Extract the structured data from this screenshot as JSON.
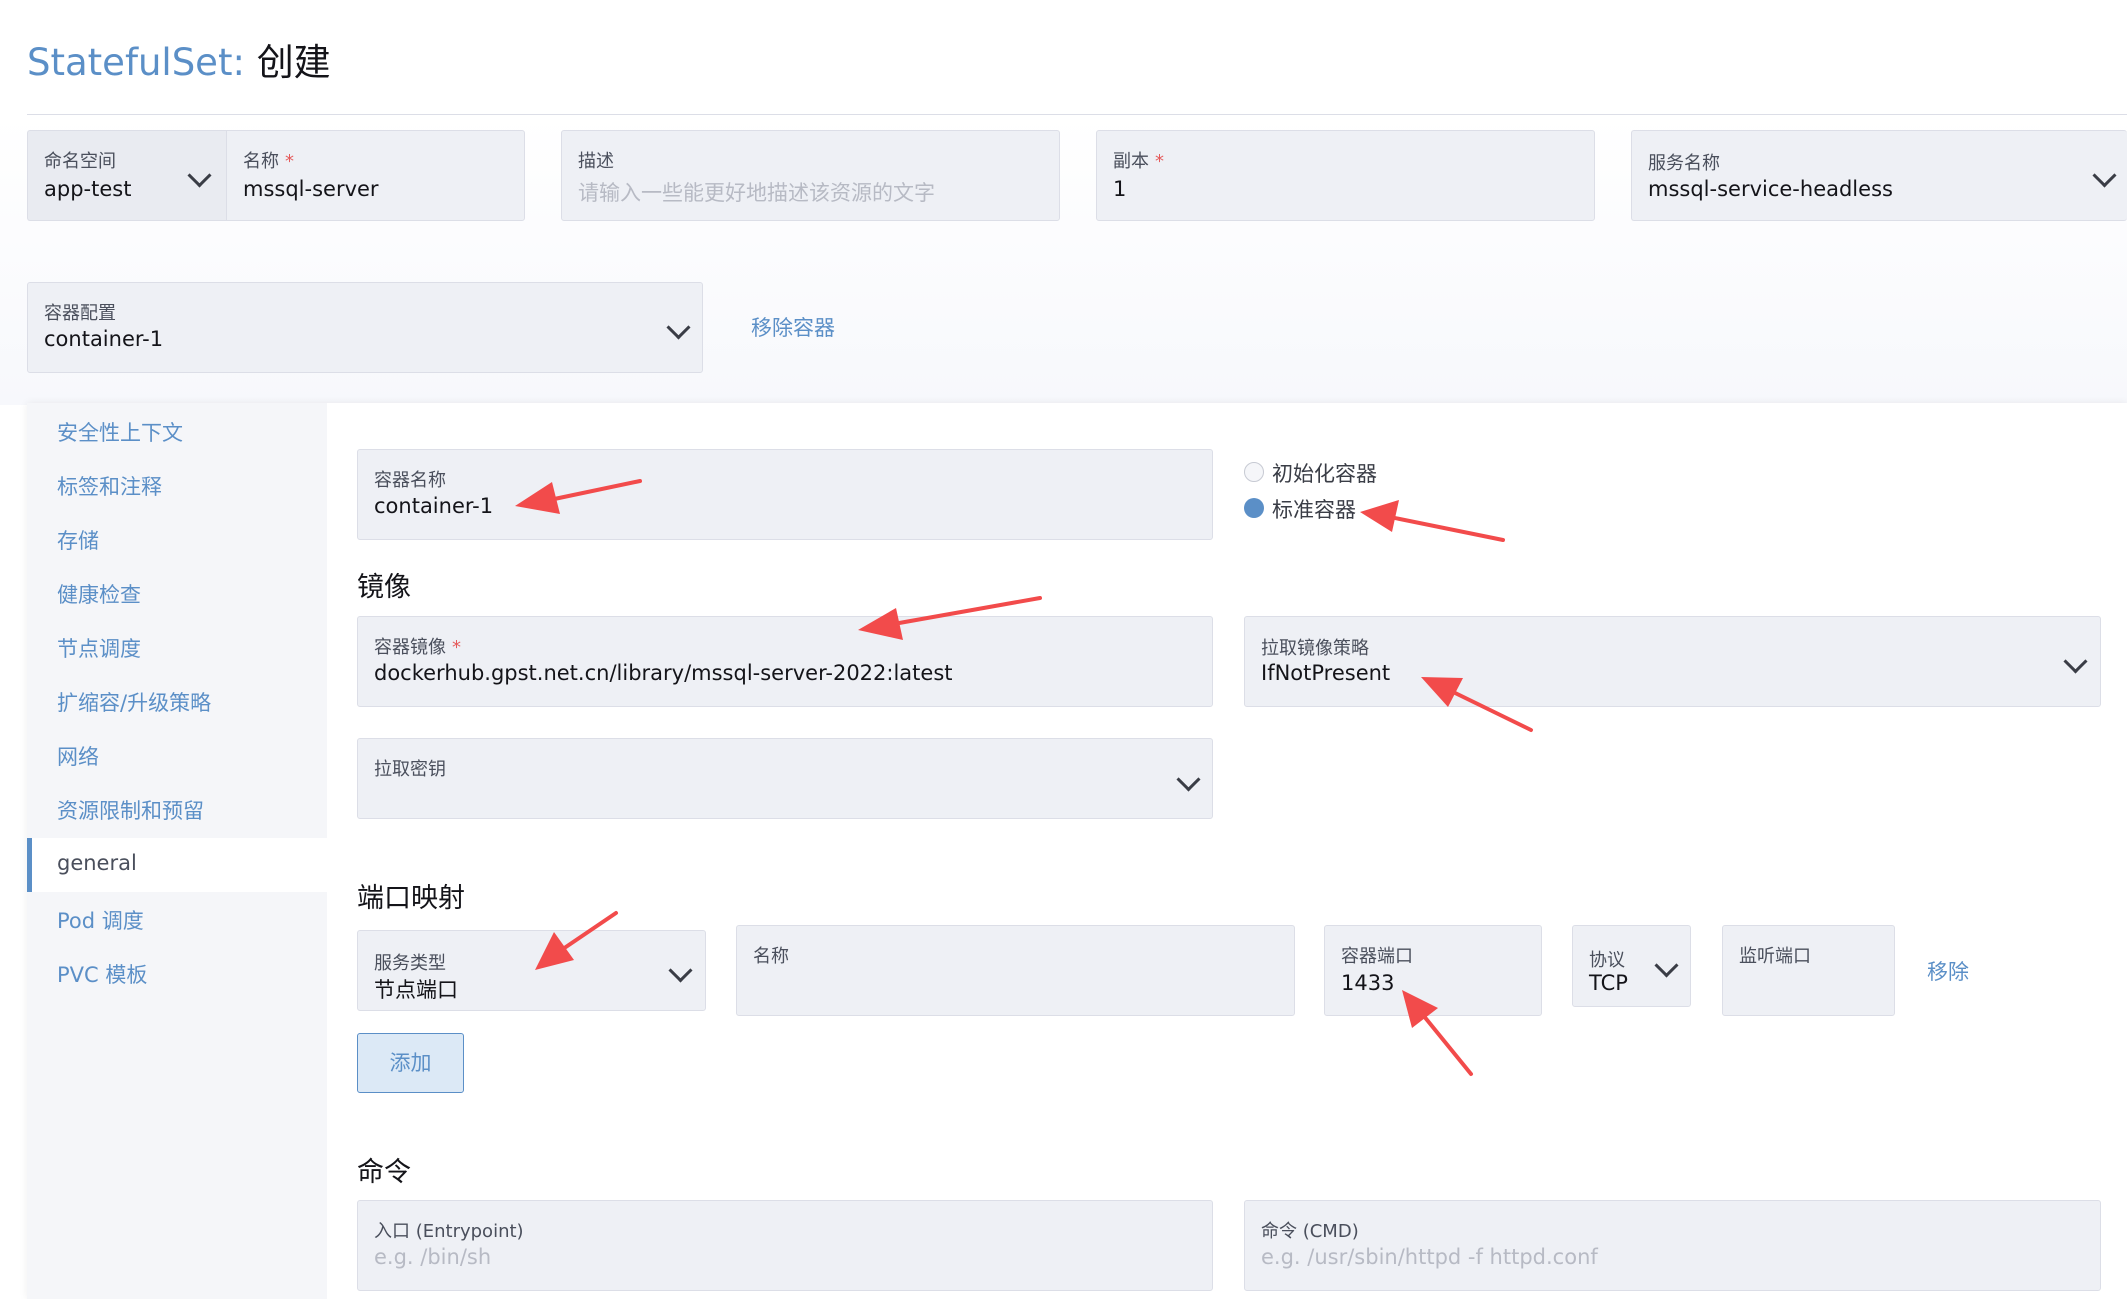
{
  "header": {
    "resource": "StatefulSet:",
    "action": "创建"
  },
  "top_fields": {
    "namespace": {
      "label": "命名空间",
      "value": "app-test"
    },
    "name": {
      "label": "名称",
      "required": "*",
      "value": "mssql-server"
    },
    "description": {
      "label": "描述",
      "placeholder": "请输入一些能更好地描述该资源的文字"
    },
    "replicas": {
      "label": "副本",
      "required": "*",
      "value": "1"
    },
    "service_name": {
      "label": "服务名称",
      "value": "mssql-service-headless"
    }
  },
  "container_config": {
    "label": "容器配置",
    "value": "container-1",
    "remove_link": "移除容器"
  },
  "sidebar": {
    "items": [
      {
        "label": "安全性上下文"
      },
      {
        "label": "标签和注释"
      },
      {
        "label": "存储"
      },
      {
        "label": "健康检查"
      },
      {
        "label": "节点调度"
      },
      {
        "label": "扩缩容/升级策略"
      },
      {
        "label": "网络"
      },
      {
        "label": "资源限制和预留"
      },
      {
        "label": "general"
      },
      {
        "label": "Pod 调度"
      },
      {
        "label": "PVC 模板"
      }
    ],
    "active": "general"
  },
  "container": {
    "name": {
      "label": "容器名称",
      "value": "container-1"
    },
    "type_options": {
      "init": "初始化容器",
      "standard": "标准容器",
      "selected": "标准容器"
    }
  },
  "image": {
    "section_title": "镜像",
    "image": {
      "label": "容器镜像",
      "required": "*",
      "value": "dockerhub.gpst.net.cn/library/mssql-server-2022:latest"
    },
    "pull_policy": {
      "label": "拉取镜像策略",
      "value": "IfNotPresent"
    },
    "pull_secret": {
      "label": "拉取密钥",
      "value": ""
    }
  },
  "ports": {
    "section_title": "端口映射",
    "service_type": {
      "label": "服务类型",
      "value": "节点端口"
    },
    "name": {
      "label": "名称",
      "value": ""
    },
    "container_port": {
      "label": "容器端口",
      "value": "1433"
    },
    "protocol": {
      "label": "协议",
      "value": "TCP"
    },
    "listen_port": {
      "label": "监听端口",
      "value": ""
    },
    "remove_link": "移除",
    "add_button": "添加"
  },
  "command": {
    "section_title": "命令",
    "entrypoint": {
      "label": "入口 (Entrypoint)",
      "placeholder": "e.g. /bin/sh"
    },
    "cmd": {
      "label": "命令 (CMD)",
      "placeholder": "e.g. /usr/sbin/httpd -f httpd.conf"
    }
  },
  "colors": {
    "accent": "#5b8fc7",
    "annotation_arrow": "#f24b4b",
    "required": "#e55a5a"
  }
}
